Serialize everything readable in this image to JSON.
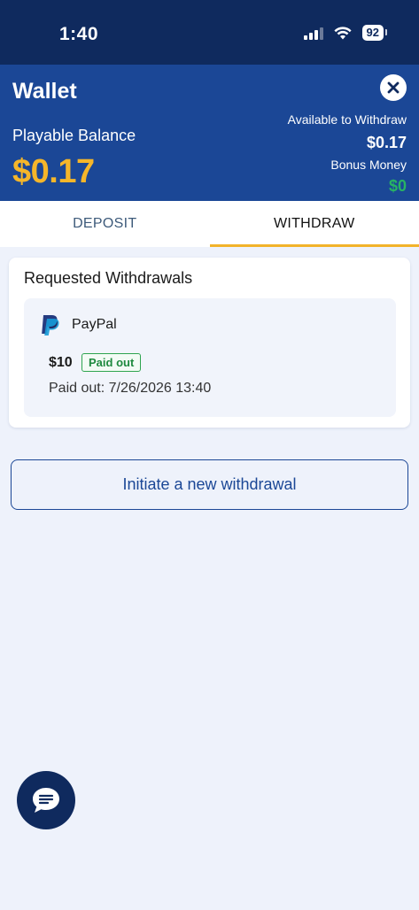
{
  "status_bar": {
    "time": "1:40",
    "battery": "92"
  },
  "header": {
    "title": "Wallet",
    "playable_label": "Playable Balance",
    "playable_amount": "$0.17",
    "available_label": "Available to Withdraw",
    "available_amount": "$0.17",
    "bonus_label": "Bonus Money",
    "bonus_amount": "$0",
    "colors": {
      "header_bg": "#1b4796",
      "playable_amount": "#f5b62a",
      "bonus_amount": "#28b463"
    }
  },
  "tabs": [
    {
      "label": "DEPOSIT",
      "active": false
    },
    {
      "label": "WITHDRAW",
      "active": true
    }
  ],
  "requested": {
    "title": "Requested Withdrawals",
    "items": [
      {
        "method_icon": "paypal-icon",
        "method": "PayPal",
        "amount": "$10",
        "status": "Paid out",
        "paid_time": "Paid out: 7/26/2026 13:40"
      }
    ]
  },
  "actions": {
    "new_withdrawal_label": "Initiate a new withdrawal"
  },
  "chat": {
    "icon": "chat-bubble-icon"
  }
}
